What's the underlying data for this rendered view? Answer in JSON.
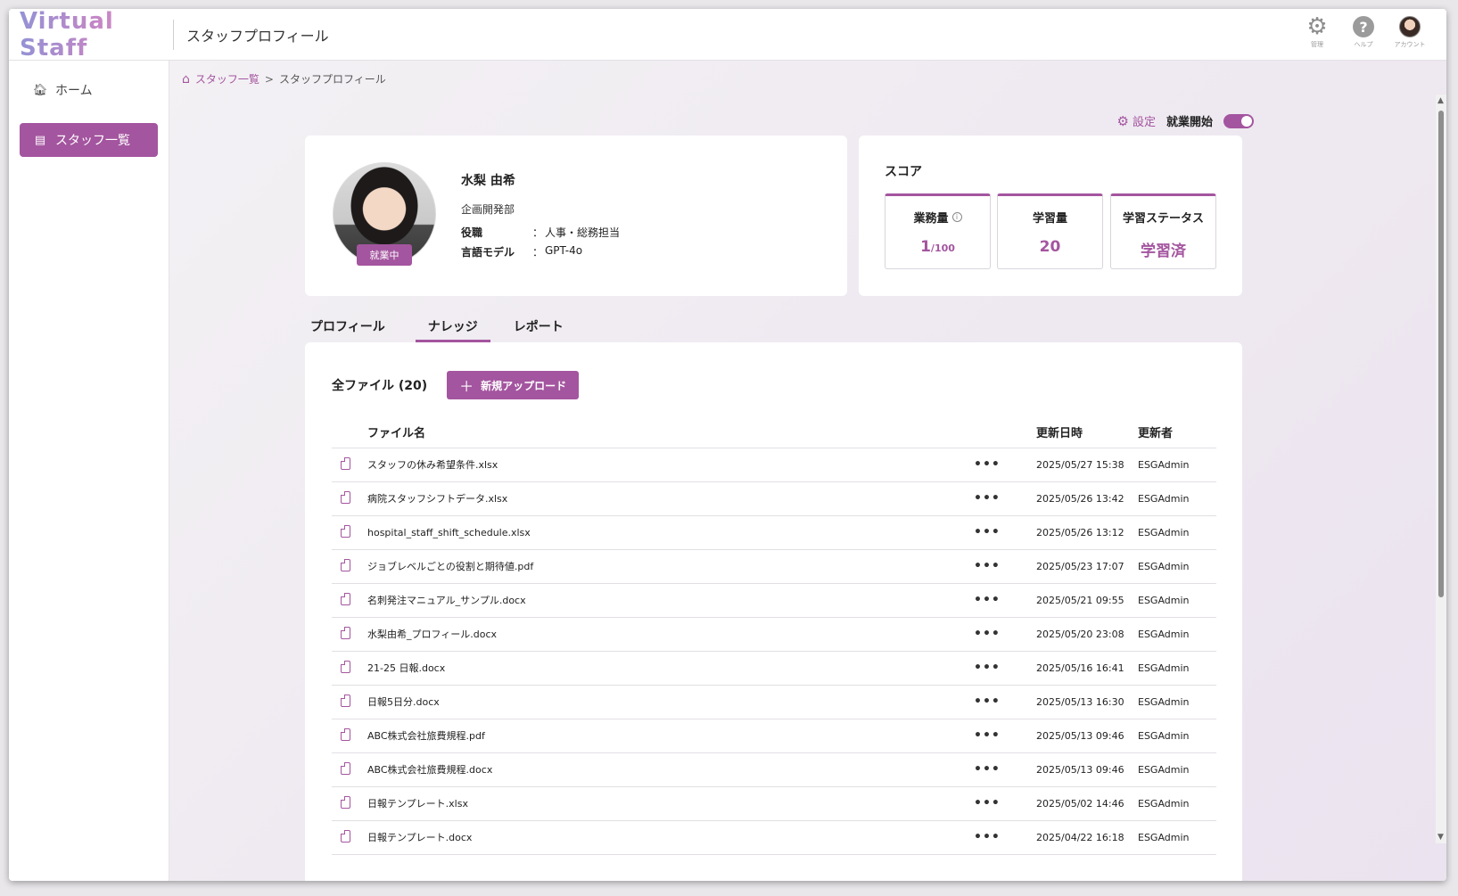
{
  "header": {
    "logo": "Virtual Staff",
    "title": "スタッフプロフィール",
    "icons": [
      {
        "name": "gear-icon",
        "caption": "管理"
      },
      {
        "name": "help-icon",
        "caption": "ヘルプ"
      },
      {
        "name": "account-icon",
        "caption": "アカウント"
      }
    ]
  },
  "sidebar": {
    "items": [
      {
        "label": "ホーム",
        "icon": "home-icon"
      },
      {
        "label": "スタッフ一覧",
        "icon": "id-card-icon"
      }
    ]
  },
  "breadcrumb": {
    "link": "スタッフ一覧",
    "separator": ">",
    "current": "スタッフプロフィール"
  },
  "actions": {
    "settings": "設定",
    "work_start": "就業開始"
  },
  "profile": {
    "name": "水梨 由希",
    "department": "企画開発部",
    "status_badge": "就業中",
    "role_label": "役職",
    "role_value": "人事・総務担当",
    "model_label": "言語モデル",
    "model_value": "GPT-4o",
    "colon": "："
  },
  "score": {
    "title": "スコア",
    "workload_label": "業務量",
    "workload_value": "1",
    "workload_max": "/100",
    "learning_label": "学習量",
    "learning_value": "20",
    "status_label": "学習ステータス",
    "status_value": "学習済"
  },
  "tabs": [
    {
      "label": "プロフィール"
    },
    {
      "label": "ナレッジ"
    },
    {
      "label": "レポート"
    }
  ],
  "files": {
    "count_label": "全ファイル (20)",
    "upload_label": "新規アップロード",
    "columns": {
      "name": "ファイル名",
      "date": "更新日時",
      "user": "更新者"
    },
    "rows": [
      {
        "name": "スタッフの休み希望条件.xlsx",
        "date": "2025/05/27 15:38",
        "user": "ESGAdmin"
      },
      {
        "name": "病院スタッフシフトデータ.xlsx",
        "date": "2025/05/26 13:42",
        "user": "ESGAdmin"
      },
      {
        "name": "hospital_staff_shift_schedule.xlsx",
        "date": "2025/05/26 13:12",
        "user": "ESGAdmin"
      },
      {
        "name": "ジョブレベルごとの役割と期待値.pdf",
        "date": "2025/05/23 17:07",
        "user": "ESGAdmin"
      },
      {
        "name": "名刺発注マニュアル_サンプル.docx",
        "date": "2025/05/21 09:55",
        "user": "ESGAdmin"
      },
      {
        "name": "水梨由希_プロフィール.docx",
        "date": "2025/05/20 23:08",
        "user": "ESGAdmin"
      },
      {
        "name": "21-25 日報.docx",
        "date": "2025/05/16 16:41",
        "user": "ESGAdmin"
      },
      {
        "name": "日報5日分.docx",
        "date": "2025/05/13 16:30",
        "user": "ESGAdmin"
      },
      {
        "name": "ABC株式会社旅費規程.pdf",
        "date": "2025/05/13 09:46",
        "user": "ESGAdmin"
      },
      {
        "name": "ABC株式会社旅費規程.docx",
        "date": "2025/05/13 09:46",
        "user": "ESGAdmin"
      },
      {
        "name": "日報テンプレート.xlsx",
        "date": "2025/05/02 14:46",
        "user": "ESGAdmin"
      },
      {
        "name": "日報テンプレート.docx",
        "date": "2025/04/22 16:18",
        "user": "ESGAdmin"
      }
    ],
    "more_glyph": "•••"
  },
  "colors": {
    "accent": "#a4559f"
  }
}
